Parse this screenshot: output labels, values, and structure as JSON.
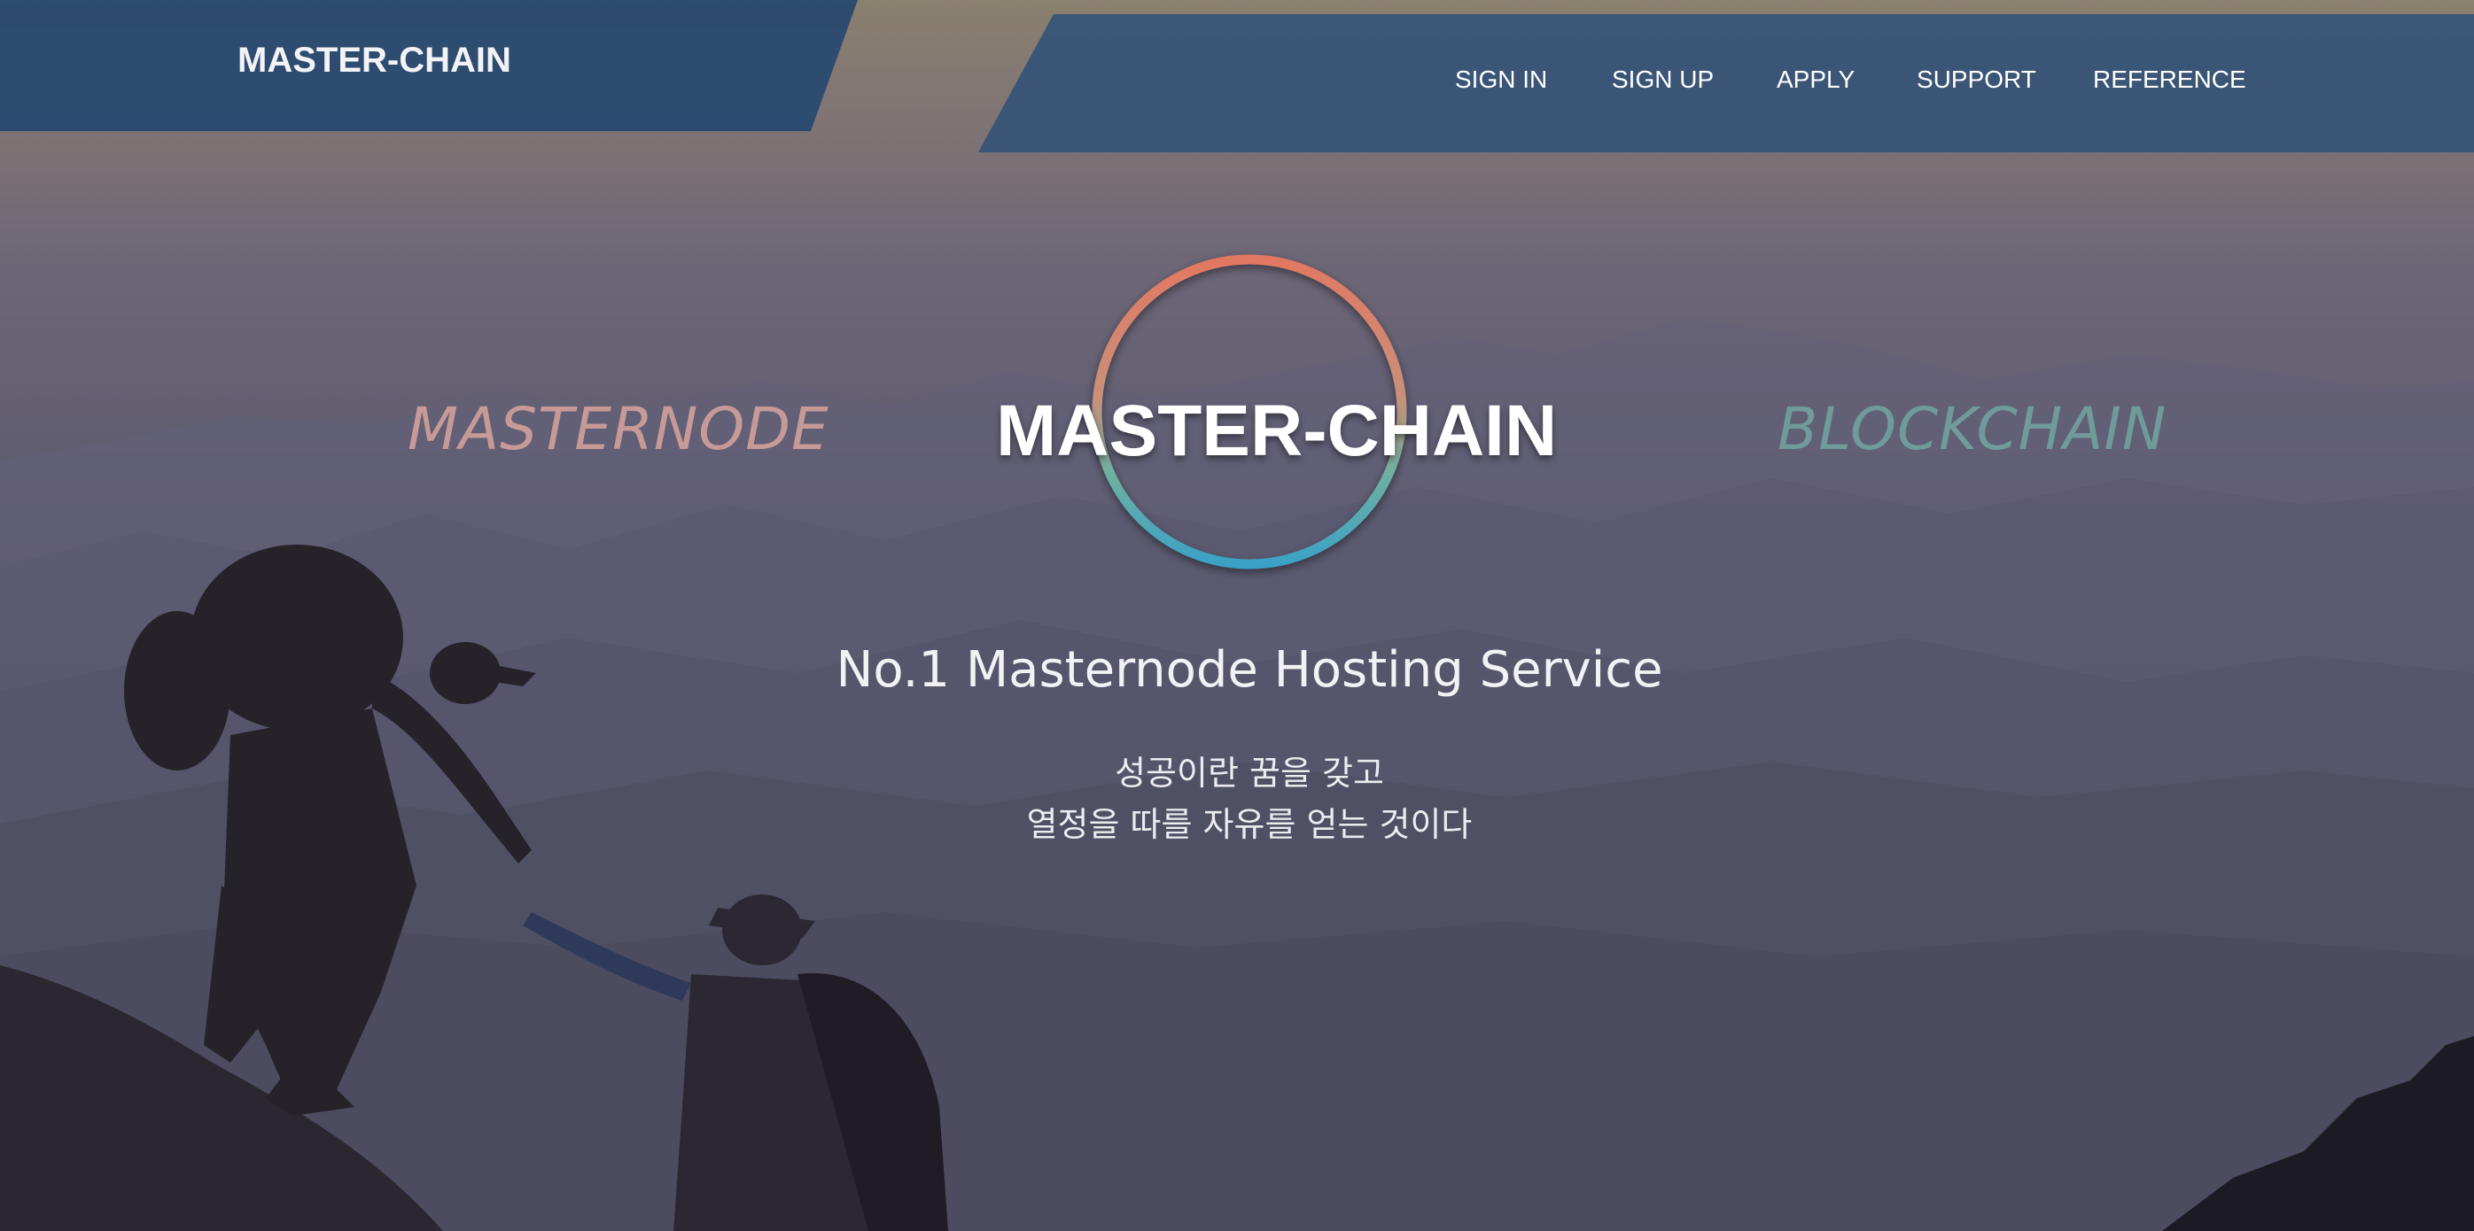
{
  "header": {
    "brand": "MASTER-CHAIN",
    "nav": [
      {
        "label": "SIGN IN"
      },
      {
        "label": "SIGN UP"
      },
      {
        "label": "APPLY"
      },
      {
        "label": "SUPPORT"
      },
      {
        "label": "REFERENCE"
      }
    ]
  },
  "hero": {
    "left_word": "MASTERNODE",
    "right_word": "BLOCKCHAIN",
    "logo_text": "MASTER-CHAIN",
    "tagline": "No.1 Masternode Hosting Service",
    "slogan_lines": [
      "성공이란 꿈을 갖고",
      "열정을 따를 자유를 얻는 것이다"
    ]
  },
  "colors": {
    "header_bg": "#2b4a72",
    "left_word": "#c79a98",
    "right_word": "#6f9c9a",
    "ring_top": "#e07a64",
    "ring_bottom": "#3aa8c8"
  },
  "background_image": "hikers-helping-on-mountain-ridge"
}
